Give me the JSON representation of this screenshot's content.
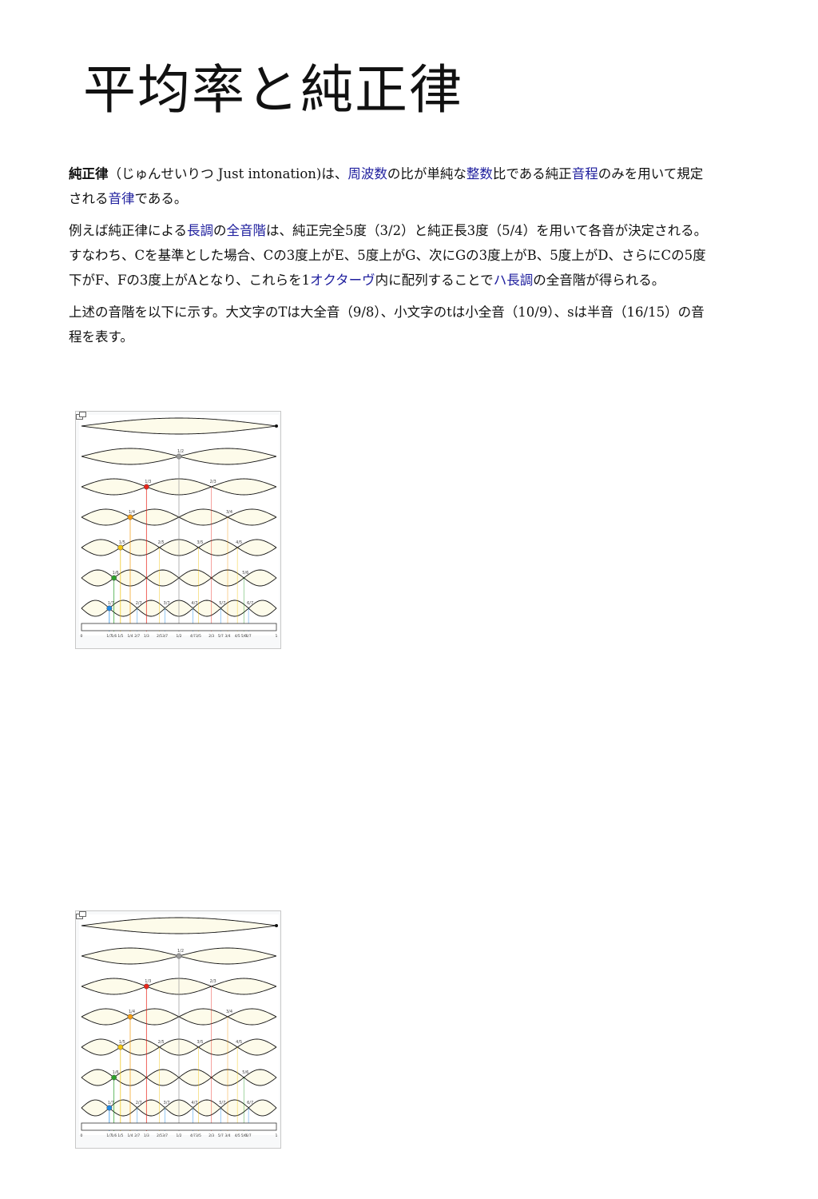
{
  "title": "平均率と純正律",
  "p1": {
    "term": "純正律",
    "t1": "（じゅんせいりつ Just intonation)は、",
    "l1": "周波数",
    "t2": "の比が単純な",
    "l2": "整数",
    "t3": "比である純正",
    "l3": "音程",
    "t4": "のみを用いて規定される",
    "l4": "音律",
    "t5": "である。"
  },
  "p2": {
    "t1": "例えば純正律による",
    "l1": "長調",
    "t2": "の",
    "l2": "全音階",
    "t3": "は、純正完全5度（3/2）と純正長3度（5/4）を用いて各音が決定される。 すなわち、Cを基準とした場合、Cの3度上がE、5度上がG、次にGの3度上がB、5度上がD、さらにCの5度下がF、Fの3度上がAとなり、これらを1",
    "l3": "オクターヴ",
    "t4": "内に配列することで",
    "l4": "ハ長調",
    "t5": "の全音階が得られる。"
  },
  "p3": {
    "t1": "上述の音階を以下に示す。大文字のTは大全音（9/8）、小文字のtは小全音（10/9）、sは半音（16/15）の音程を表す。"
  },
  "figure": {
    "icon": "magnify-icon",
    "colors": [
      "#9a9a9a",
      "#e8261c",
      "#f39c12",
      "#f1c40f",
      "#2ca02c",
      "#1e88e5"
    ],
    "harmonic_labels": [
      [
        "1/2"
      ],
      [
        "1/3",
        "2/3"
      ],
      [
        "1/4",
        "3/4"
      ],
      [
        "1/5",
        "2/5",
        "3/5",
        "4/5"
      ],
      [
        "1/6",
        "5/6"
      ],
      [
        "1/7",
        "2/7",
        "3/7",
        "4/7",
        "5/7",
        "6/7"
      ]
    ],
    "scale_start": "0",
    "scale_end": "1",
    "scale_labels": [
      "1/7",
      "1/6",
      "1/5",
      "1/4",
      "2/7",
      "1/3",
      "2/5",
      "3/7",
      "1/2",
      "4/7",
      "3/5",
      "2/3",
      "5/7",
      "3/4",
      "4/5",
      "5/6",
      "6/7"
    ]
  }
}
